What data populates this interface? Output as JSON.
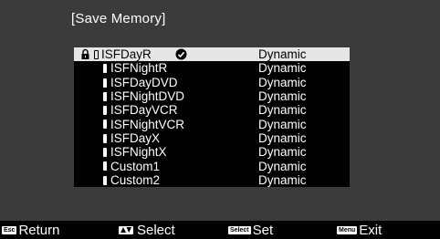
{
  "title": "[Save Memory]",
  "items": [
    {
      "name": "ISFDayR",
      "value": "Dynamic",
      "selected": true
    },
    {
      "name": "ISFNightR",
      "value": "Dynamic"
    },
    {
      "name": "ISFDayDVD",
      "value": "Dynamic"
    },
    {
      "name": "ISFNightDVD",
      "value": "Dynamic"
    },
    {
      "name": "ISFDayVCR",
      "value": "Dynamic"
    },
    {
      "name": "ISFNightVCR",
      "value": "Dynamic"
    },
    {
      "name": "ISFDayX",
      "value": "Dynamic"
    },
    {
      "name": "ISFNightX",
      "value": "Dynamic"
    },
    {
      "name": "Custom1",
      "value": "Dynamic"
    },
    {
      "name": "Custom2",
      "value": "Dynamic"
    }
  ],
  "footer": {
    "return": {
      "badge": "Esc",
      "label": "Return"
    },
    "select": {
      "label": "Select"
    },
    "set": {
      "badge": "Select",
      "label": "Set"
    },
    "exit": {
      "badge": "Menu",
      "label": "Exit"
    }
  }
}
